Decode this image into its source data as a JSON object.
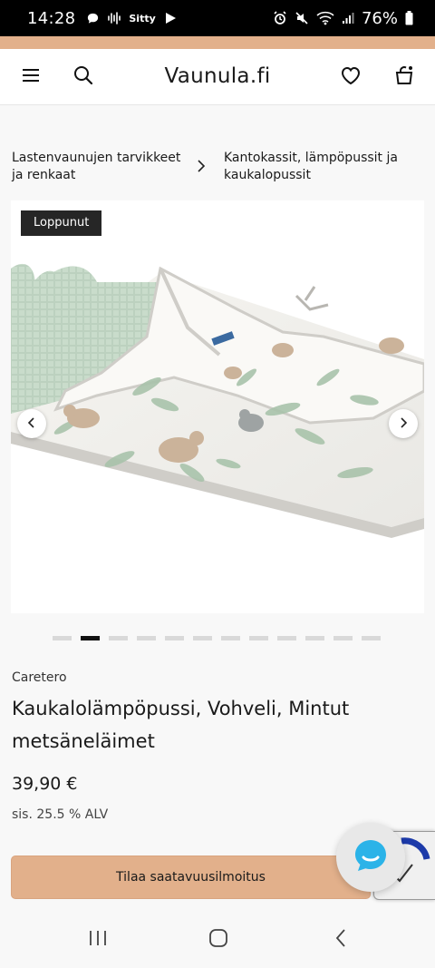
{
  "status_bar": {
    "time": "14:28",
    "carrier_badge": "Sitty",
    "battery": "76%"
  },
  "header": {
    "logo": "Vaunula.fi",
    "icons": [
      "menu-icon",
      "search-icon",
      "heart-icon",
      "shopping-bag-icon"
    ]
  },
  "breadcrumb": {
    "items": [
      "Lastenvaunujen tarvikkeet ja renkaat",
      "Kantokassit, lämpöpussit ja kaukalopussit"
    ]
  },
  "gallery": {
    "badge": "Loppunut",
    "dot_count": 12,
    "active_dot": 2
  },
  "product": {
    "brand": "Caretero",
    "title": "Kaukalolämpöpussi, Vohveli, Mintut metsäneläimet",
    "price": "39,90 €",
    "vat": "sis. 25.5 % ALV",
    "notify_label": "Tilaa saatavuusilmoitus"
  },
  "colors": {
    "accent": "#e2b08b",
    "chat": "#2bb3e8",
    "badge_bg": "#262626"
  }
}
